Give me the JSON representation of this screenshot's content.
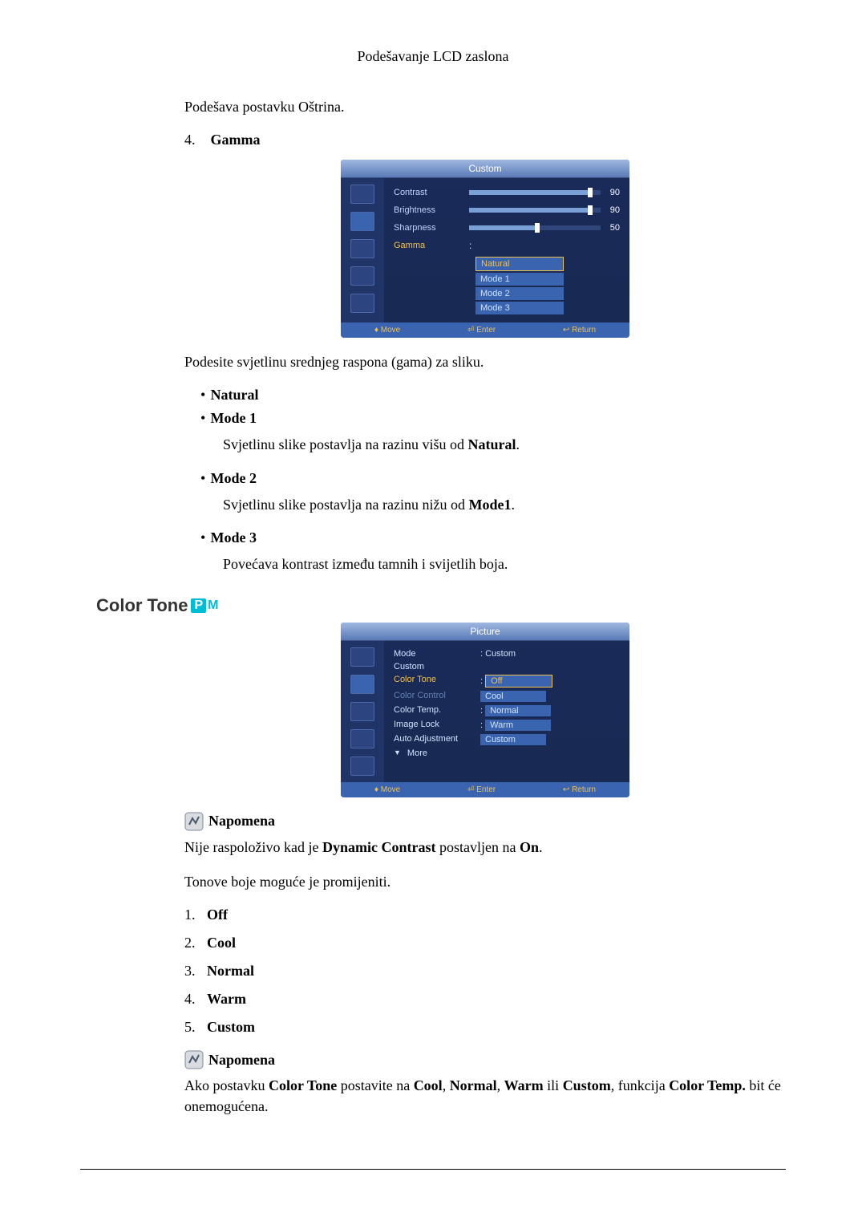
{
  "header": {
    "title": "Podešavanje LCD zaslona"
  },
  "intro_line": "Podešava postavku Oštrina.",
  "gamma": {
    "number": "4.",
    "title": "Gamma",
    "osd": {
      "title": "Custom",
      "rows": {
        "contrast": {
          "label": "Contrast",
          "value": "90"
        },
        "brightness": {
          "label": "Brightness",
          "value": "90"
        },
        "sharpness": {
          "label": "Sharpness",
          "value": "50"
        },
        "gamma_label": "Gamma"
      },
      "options": {
        "o1": "Natural",
        "o2": "Mode 1",
        "o3": "Mode 2",
        "o4": "Mode 3"
      },
      "footer": {
        "move": "Move",
        "enter": "Enter",
        "ret": "Return"
      }
    },
    "after_osd": "Podesite svjetlinu srednjeg raspona (gama) za sliku.",
    "bullets": {
      "natural": "Natural",
      "mode1": "Mode 1",
      "mode1_desc_pre": "Svjetlinu slike postavlja na razinu višu od ",
      "mode1_desc_bold": "Natural",
      "mode2": "Mode 2",
      "mode2_desc_pre": "Svjetlinu slike postavlja na razinu nižu od ",
      "mode2_desc_bold": "Mode1",
      "mode3": "Mode 3",
      "mode3_desc": "Povećava kontrast između tamnih i svijetlih boja."
    }
  },
  "color_tone": {
    "title": "Color Tone",
    "badge_p": "P",
    "badge_m": "M",
    "osd": {
      "title": "Picture",
      "rows": {
        "mode_label": "Mode",
        "mode_value": ": Custom",
        "custom_label": "Custom",
        "color_tone_label": "Color Tone",
        "color_control_label": "Color Control",
        "color_temp_label": "Color Temp.",
        "image_lock_label": "Image Lock",
        "auto_adj_label": "Auto Adjustment",
        "more_label": "More"
      },
      "options": {
        "off": "Off",
        "cool": "Cool",
        "normal": "Normal",
        "warm": "Warm",
        "custom": "Custom"
      },
      "footer": {
        "move": "Move",
        "enter": "Enter",
        "ret": "Return"
      }
    },
    "note1": {
      "label": "Napomena",
      "text_pre": "Nije raspoloživo kad je ",
      "text_b1": "Dynamic Contrast",
      "text_mid": " postavljen na ",
      "text_b2": "On"
    },
    "para2": "Tonove boje moguće je promijeniti.",
    "list": {
      "n1": "1.",
      "l1": "Off",
      "n2": "2.",
      "l2": "Cool",
      "n3": "3.",
      "l3": "Normal",
      "n4": "4.",
      "l4": "Warm",
      "n5": "5.",
      "l5": "Custom"
    },
    "note2": {
      "label": "Napomena",
      "text_pre": "Ako postavku ",
      "b1": "Color Tone",
      "t2": " postavite na ",
      "b2": "Cool",
      "t3": ", ",
      "b3": "Normal",
      "t4": ", ",
      "b4": "Warm",
      "t5": " ili ",
      "b5": "Custom",
      "t6": ", funkcija ",
      "b6": "Color Temp.",
      "t7": " bit će onemogućena."
    }
  }
}
